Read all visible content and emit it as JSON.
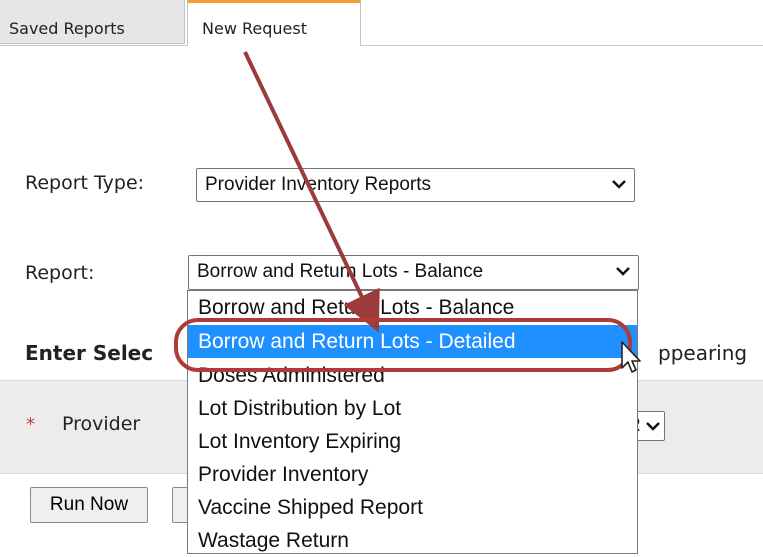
{
  "tabs": [
    {
      "label": "Saved Reports"
    },
    {
      "label": "New Request"
    }
  ],
  "form": {
    "report_type_label": "Report Type:",
    "report_type_value": "Provider Inventory Reports",
    "report_label": "Report:",
    "report_value": "Borrow and Return Lots - Balance",
    "section_heading_left": "Enter Selec",
    "section_heading_right": "ppearing",
    "required_marker": "*",
    "provider_label": "Provider",
    "provider_select_partial": "R"
  },
  "buttons": {
    "run_now": "Run Now"
  },
  "dropdown": {
    "options": [
      "Borrow and Return Lots - Balance",
      "Borrow and Return Lots - Detailed",
      "Doses Administered",
      "Lot Distribution by Lot",
      "Lot Inventory Expiring",
      "Provider Inventory",
      "Vaccine Shipped Report",
      "Wastage Return"
    ],
    "highlighted_index": 1
  },
  "annotations": {
    "arrow_color": "#9b3b3b",
    "highlight_color": "#b03a3a"
  },
  "colors": {
    "active_tab_accent": "#f0a030",
    "selection_blue": "#1e90ff",
    "required_red": "#d23b3b"
  }
}
